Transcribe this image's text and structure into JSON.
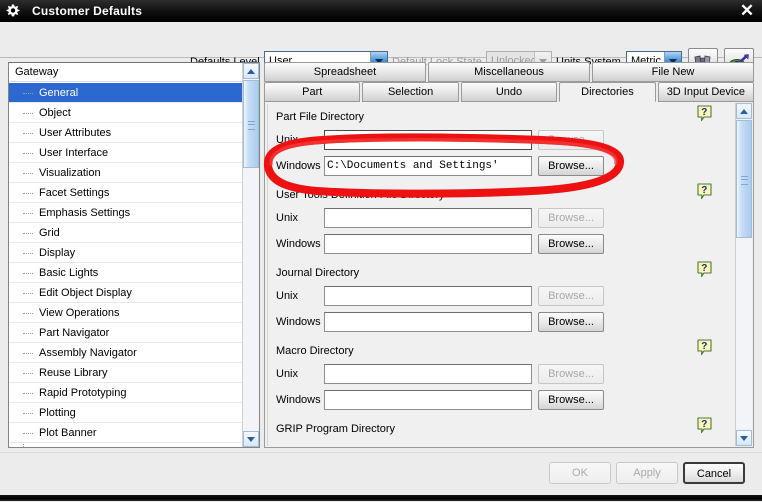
{
  "window": {
    "title": "Customer Defaults",
    "icon": "gear-icon",
    "close_label": "✕"
  },
  "toolbar": {
    "defaults_level_label": "Defaults Level",
    "defaults_level_value": "User",
    "default_lock_state_label": "Default Lock State",
    "default_lock_state_value": "Unlocked",
    "units_system_label": "Units System",
    "units_system_value": "Metric",
    "find_button_icon": "binoculars-icon",
    "visual_button_icon": "eye-arrow-icon"
  },
  "sidebar": {
    "header": "Gateway",
    "items": [
      {
        "label": "General",
        "selected": true
      },
      {
        "label": "Object",
        "selected": false
      },
      {
        "label": "User Attributes",
        "selected": false
      },
      {
        "label": "User Interface",
        "selected": false
      },
      {
        "label": "Visualization",
        "selected": false
      },
      {
        "label": "Facet Settings",
        "selected": false
      },
      {
        "label": "Emphasis Settings",
        "selected": false
      },
      {
        "label": "Grid",
        "selected": false
      },
      {
        "label": "Display",
        "selected": false
      },
      {
        "label": "Basic Lights",
        "selected": false
      },
      {
        "label": "Edit Object Display",
        "selected": false
      },
      {
        "label": "View Operations",
        "selected": false
      },
      {
        "label": "Part Navigator",
        "selected": false
      },
      {
        "label": "Assembly Navigator",
        "selected": false
      },
      {
        "label": "Reuse Library",
        "selected": false
      },
      {
        "label": "Rapid Prototyping",
        "selected": false
      },
      {
        "label": "Plotting",
        "selected": false
      },
      {
        "label": "Plot Banner",
        "selected": false
      }
    ]
  },
  "tabs": {
    "row1": [
      {
        "label": "Spreadsheet",
        "active": false
      },
      {
        "label": "Miscellaneous",
        "active": false
      },
      {
        "label": "File New",
        "active": false
      }
    ],
    "row2": [
      {
        "label": "Part",
        "active": false
      },
      {
        "label": "Selection",
        "active": false
      },
      {
        "label": "Undo",
        "active": false
      },
      {
        "label": "Directories",
        "active": true
      },
      {
        "label": "3D Input Device",
        "active": false
      }
    ]
  },
  "form": {
    "groups": [
      {
        "title": "Part File Directory",
        "rows": [
          {
            "label": "Unix",
            "value": "",
            "browse": "Browse...",
            "browse_enabled": false,
            "focused": true
          },
          {
            "label": "Windows",
            "value": "C:\\Documents and Settings'",
            "browse": "Browse...",
            "browse_enabled": true,
            "focused": false
          }
        ]
      },
      {
        "title": "User Tools Definition File Directory",
        "rows": [
          {
            "label": "Unix",
            "value": "",
            "browse": "Browse...",
            "browse_enabled": false,
            "focused": false
          },
          {
            "label": "Windows",
            "value": "",
            "browse": "Browse...",
            "browse_enabled": true,
            "focused": false
          }
        ]
      },
      {
        "title": "Journal Directory",
        "rows": [
          {
            "label": "Unix",
            "value": "",
            "browse": "Browse...",
            "browse_enabled": false,
            "focused": false
          },
          {
            "label": "Windows",
            "value": "",
            "browse": "Browse...",
            "browse_enabled": true,
            "focused": false
          }
        ]
      },
      {
        "title": "Macro Directory",
        "rows": [
          {
            "label": "Unix",
            "value": "",
            "browse": "Browse...",
            "browse_enabled": false,
            "focused": false
          },
          {
            "label": "Windows",
            "value": "",
            "browse": "Browse...",
            "browse_enabled": true,
            "focused": false
          }
        ]
      },
      {
        "title": "GRIP Program Directory",
        "rows": []
      }
    ],
    "help_icon": "help-question-icon"
  },
  "footer": {
    "ok_label": "OK",
    "ok_enabled": false,
    "apply_label": "Apply",
    "apply_enabled": false,
    "cancel_label": "Cancel",
    "cancel_enabled": true
  },
  "annotation": {
    "type": "hand-drawn-ellipse",
    "color": "#ee1111"
  }
}
